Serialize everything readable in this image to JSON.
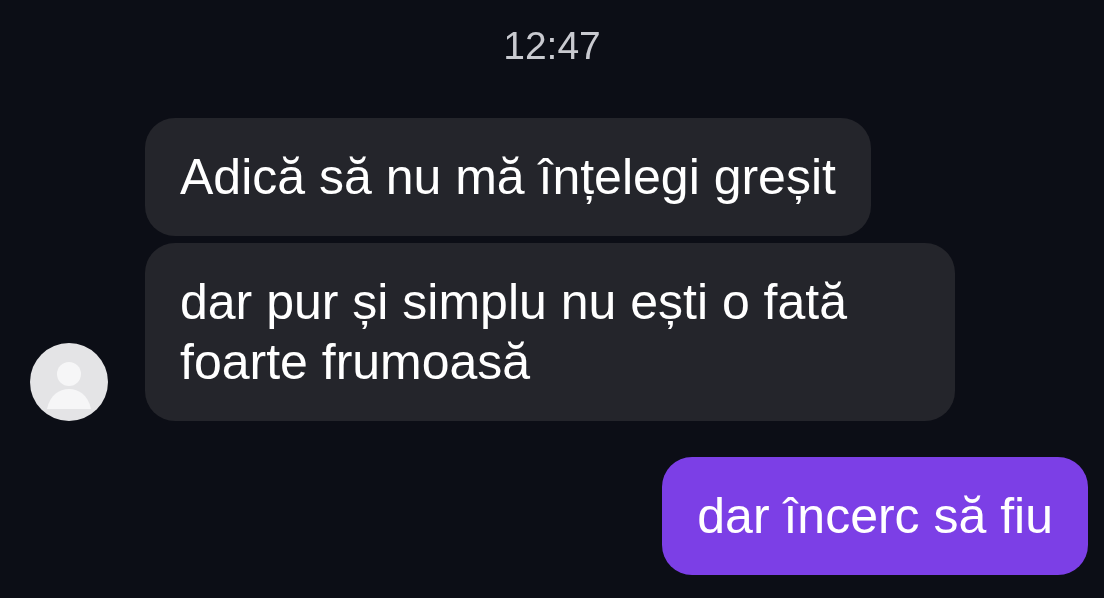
{
  "time": "12:47",
  "messages": [
    {
      "kind": "received",
      "text": "Adică să nu mă înțelegi greșit"
    },
    {
      "kind": "received",
      "text": "dar pur și simplu nu ești o fată foarte frumoasă"
    },
    {
      "kind": "sent",
      "text": "dar încerc să fiu"
    }
  ]
}
